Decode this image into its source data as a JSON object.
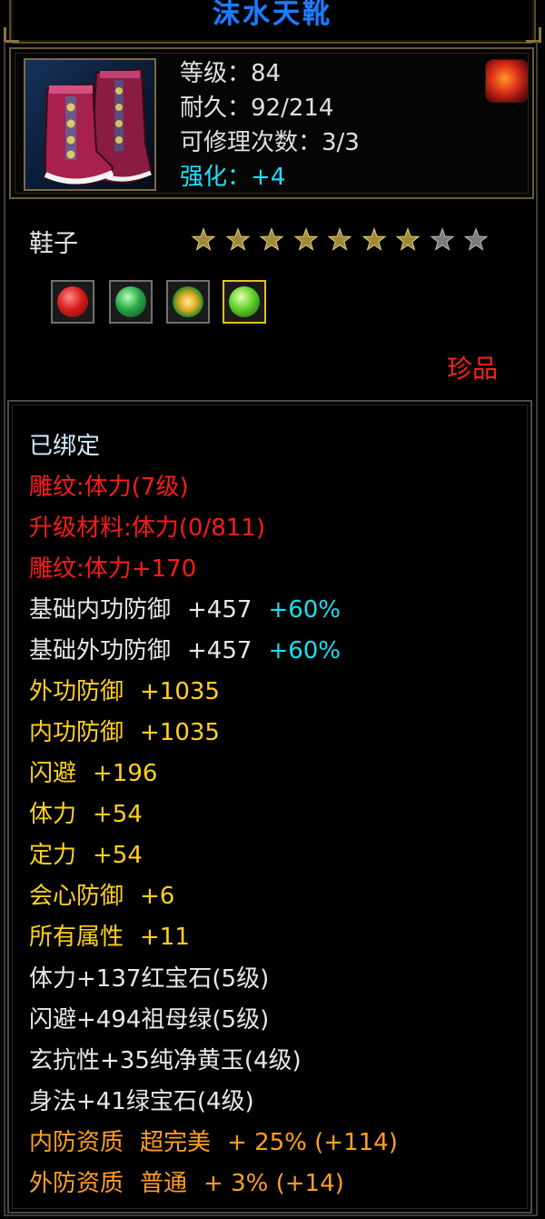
{
  "item": {
    "name": "沫水天靴",
    "level_label": "等级：84",
    "durability_label": "耐久：92/214",
    "repair_label": "可修理次数：3/3",
    "enhance_label": "强化：+4",
    "category": "鞋子",
    "rarity": "珍品",
    "stars_total": 9,
    "stars_filled": 7
  },
  "gems": [
    {
      "name": "ruby-gem",
      "color": "#d81e1e"
    },
    {
      "name": "emerald-gem",
      "color": "#2aa84a"
    },
    {
      "name": "topaz-gem",
      "color": "#e0a820"
    },
    {
      "name": "green-gem",
      "color": "#5fd02a"
    }
  ],
  "details": {
    "bound": "已绑定",
    "engrave_level": "雕纹:体力(7级)",
    "upgrade_material": "升级材料:体力(0/811)",
    "engrave_bonus": "雕纹:体力+170",
    "base_inner_def": {
      "label": "基础内功防御",
      "value": "+457",
      "bonus": "+60%"
    },
    "base_outer_def": {
      "label": "基础外功防御",
      "value": "+457",
      "bonus": "+60%"
    },
    "outer_def": {
      "label": "外功防御",
      "value": "+1035"
    },
    "inner_def": {
      "label": "内功防御",
      "value": "+1035"
    },
    "dodge": {
      "label": "闪避",
      "value": "+196"
    },
    "stamina": {
      "label": "体力",
      "value": "+54"
    },
    "focus": {
      "label": "定力",
      "value": "+54"
    },
    "crit_def": {
      "label": "会心防御",
      "value": "+6"
    },
    "all_attr": {
      "label": "所有属性",
      "value": "+11"
    },
    "gem_line_1": "体力+137红宝石(5级)",
    "gem_line_2": "闪避+494祖母绿(5级)",
    "gem_line_3": "玄抗性+35纯净黄玉(4级)",
    "gem_line_4": "身法+41绿宝石(4级)",
    "inner_quality": {
      "label": "内防资质",
      "grade": "超完美",
      "value": "+ 25% (+114)"
    },
    "outer_quality": {
      "label": "外防资质",
      "grade": "普通",
      "value": "+ 3% (+14)"
    }
  }
}
